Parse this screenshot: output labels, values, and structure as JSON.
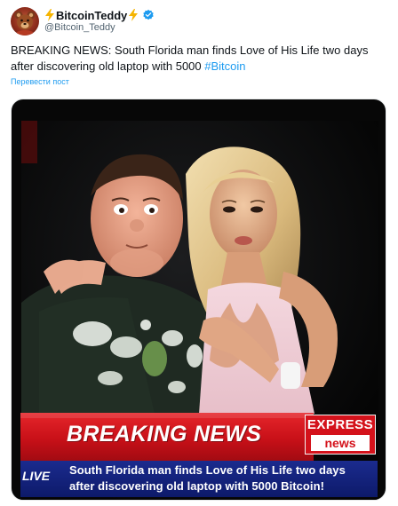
{
  "tweet": {
    "author": {
      "display_name": "BitcoinTeddy",
      "handle": "@Bitcoin_Teddy",
      "avatar_icon": "teddy-bear-avatar-icon",
      "verified_icon": "verified-badge-icon",
      "bolt_icon": "lightning-bolt-icon"
    },
    "text_main": "BREAKING NEWS: South Florida man finds Love of His Life two days after discovering old laptop with 5000 ",
    "hashtag": "#Bitcoin",
    "translate_label": "Перевести пост",
    "more_icon": "more-options-icon"
  },
  "media": {
    "banner_title": "BREAKING NEWS",
    "badge_top": "EXPRESS",
    "badge_bottom": "news",
    "live_label": "LIVE",
    "ticker_line_1": "South Florida man finds Love of His Life two days",
    "ticker_line_2": "after discovering old laptop with 5000 Bitcoin!"
  },
  "colors": {
    "link": "#1d9bf0",
    "text": "#0f1419",
    "secondary": "#536471",
    "banner_red": "#c81018",
    "ticker_blue": "#0d1a6a",
    "verified_blue": "#1d9bf0",
    "bolt_yellow": "#f5b400"
  }
}
